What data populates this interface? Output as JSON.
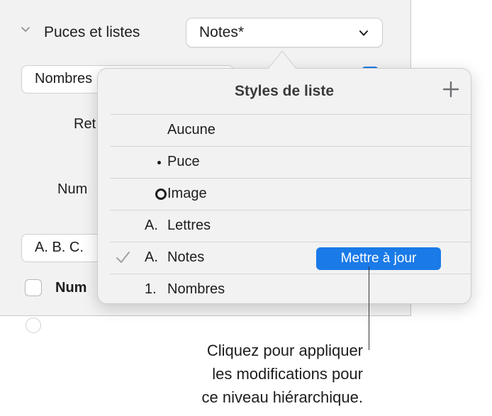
{
  "panel": {
    "section_title": "Puces et listes",
    "style_popup_value": "Notes*",
    "field_top_text": "Nombres",
    "label_indent": "Ret",
    "label_numbering": "Num",
    "field_format_text": "A. B. C.",
    "checkbox_label": "Num",
    "accent_color": "#1a7ae8"
  },
  "popover": {
    "title": "Styles de liste",
    "items": [
      {
        "marker": "",
        "label": "Aucune",
        "selected": false
      },
      {
        "marker": "•",
        "label": "Puce",
        "selected": false
      },
      {
        "marker": "ring",
        "label": "Image",
        "selected": false
      },
      {
        "marker": "A.",
        "label": "Lettres",
        "selected": false
      },
      {
        "marker": "A.",
        "label": "Notes",
        "selected": true
      },
      {
        "marker": "1.",
        "label": "Nombres",
        "selected": false
      }
    ],
    "update_button": "Mettre à jour"
  },
  "callout": {
    "line1": "Cliquez pour appliquer",
    "line2": "les modifications pour",
    "line3": "ce niveau hiérarchique."
  }
}
